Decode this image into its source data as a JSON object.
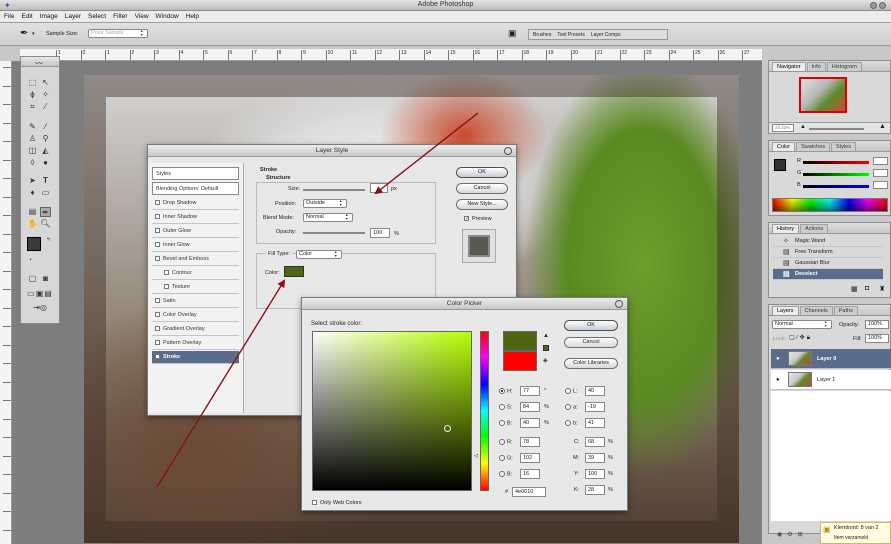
{
  "app": {
    "title": "Adobe Photoshop"
  },
  "menu": [
    "File",
    "Edit",
    "Image",
    "Layer",
    "Select",
    "Filter",
    "View",
    "Window",
    "Help"
  ],
  "options": {
    "sample_size_label": "Sample Size:",
    "sample_size_value": "Point Sample"
  },
  "well_tabs": [
    "Brushes",
    "Tool Presets",
    "Layer Comps"
  ],
  "ruler_top": [
    "1",
    "0",
    "1",
    "2",
    "3",
    "4",
    "5",
    "6",
    "7",
    "8",
    "9",
    "10",
    "11",
    "12",
    "13",
    "14",
    "15",
    "16",
    "17",
    "18",
    "19",
    "20",
    "21",
    "22",
    "23",
    "24",
    "25",
    "26",
    "27"
  ],
  "layer_style": {
    "title": "Layer Style",
    "styles": [
      "Styles",
      "Blending Options: Default",
      "Drop Shadow",
      "Inner Shadow",
      "Outer Glow",
      "Inner Glow",
      "Bevel and Emboss",
      "Contour",
      "Texture",
      "Satin",
      "Color Overlay",
      "Gradient Overlay",
      "Pattern Overlay",
      "Stroke"
    ],
    "section_title": "Stroke",
    "structure_title": "Structure",
    "size_label": "Size:",
    "size_value": "",
    "size_unit": "px",
    "position_label": "Position:",
    "position_value": "Outside",
    "blend_label": "Blend Mode:",
    "blend_value": "Normal",
    "opacity_label": "Opacity:",
    "opacity_value": "100",
    "opacity_unit": "%",
    "fill_type_label": "Fill Type:",
    "fill_type_value": "Color",
    "color_label": "Color:",
    "stroke_color": "#4e6610",
    "buttons": {
      "ok": "OK",
      "cancel": "Cancel",
      "new_style": "New Style...",
      "preview": "Preview"
    }
  },
  "color_picker": {
    "title": "Color Picker",
    "prompt": "Select stroke color:",
    "buttons": {
      "ok": "OK",
      "cancel": "Cancel",
      "libraries": "Color Libraries"
    },
    "hsb": {
      "h": "77",
      "h_unit": "°",
      "s": "84",
      "s_unit": "%",
      "b": "40",
      "b_unit": "%"
    },
    "rgb": {
      "r": "78",
      "g": "102",
      "b": "16"
    },
    "lab": {
      "l": "40",
      "a": "-19",
      "b": "41"
    },
    "cmyk": {
      "c": "68",
      "m": "39",
      "y": "100",
      "k": "28",
      "unit": "%"
    },
    "labels": {
      "h": "H:",
      "s": "S:",
      "b": "B:",
      "r": "R:",
      "g": "G:",
      "bb": "B:",
      "l": "L:",
      "a": "a:",
      "lb": "b:",
      "c": "C:",
      "m": "M:",
      "y": "Y:",
      "k": "K:"
    },
    "hex_label": "#",
    "hex": "4e6610",
    "web_colors": "Only Web Colors",
    "new_color": "#4e6610",
    "current_color": "#ff0000"
  },
  "navigator": {
    "tabs": [
      "Navigator",
      "Info",
      "Histogram"
    ],
    "zoom": "33,33%"
  },
  "color_palette": {
    "tabs": [
      "Color",
      "Swatches",
      "Styles"
    ],
    "labels": [
      "R",
      "G",
      "B"
    ]
  },
  "history": {
    "tabs": [
      "History",
      "Actions"
    ],
    "items": [
      "Magic Wand",
      "Free Transform",
      "Gaussian Blur",
      "Deselect"
    ]
  },
  "layers": {
    "tabs": [
      "Layers",
      "Channels",
      "Paths"
    ],
    "blend_mode": "Normal",
    "opacity_label": "Opacity:",
    "opacity_value": "100%",
    "lock_label": "Lock:",
    "fill_label": "Fill:",
    "fill_value": "100%",
    "items": [
      "Layer 0",
      "Layer 1"
    ]
  },
  "clipboard": {
    "title": "Klembord: 8 van 2",
    "subtitle": "Item verzameld"
  },
  "colors": {
    "accent": "#4e6610",
    "arrow": "#8b1010",
    "selected": "#5a6c8c"
  }
}
